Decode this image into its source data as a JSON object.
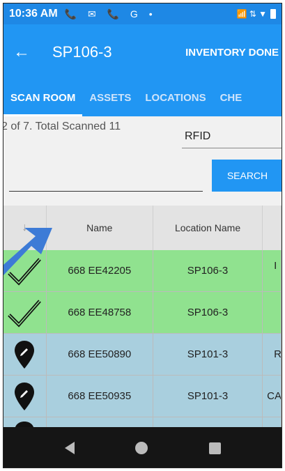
{
  "status_bar": {
    "time": "10:36 AM",
    "notification_icons": "📞 ✉ 📞 G •",
    "system_icons": "📶 ⇅ ▼"
  },
  "app_bar": {
    "title": "SP106-3",
    "action": "INVENTORY DONE"
  },
  "tabs": [
    {
      "label": "SCAN ROOM",
      "active": true
    },
    {
      "label": "ASSETS",
      "active": false
    },
    {
      "label": "LOCATIONS",
      "active": false
    },
    {
      "label": "CHE",
      "active": false
    }
  ],
  "scan": {
    "count_text": "2 of 7. Total Scanned 11",
    "mode_value": "RFID",
    "search_placeholder": "",
    "search_label": "SEARCH"
  },
  "table": {
    "columns": [
      "",
      "Name",
      "Location Name",
      ""
    ],
    "rows": [
      {
        "status": "scanned",
        "name": "668 EE42205",
        "location": "SP106-3",
        "extra": "I"
      },
      {
        "status": "scanned",
        "name": "668 EE48758",
        "location": "SP106-3",
        "extra": ""
      },
      {
        "status": "misplaced",
        "name": "668 EE50890",
        "location": "SP101-3",
        "extra": "R"
      },
      {
        "status": "misplaced",
        "name": "668 EE50935",
        "location": "SP101-3",
        "extra": "CA"
      },
      {
        "status": "misplaced",
        "name": "",
        "location": "",
        "extra": ""
      }
    ]
  },
  "colors": {
    "primary": "#2196f3",
    "status_bar": "#1e88e5",
    "scanned_row": "#90e28f",
    "misplaced_row": "#a9cfde",
    "arrow": "#3d7bd6"
  }
}
